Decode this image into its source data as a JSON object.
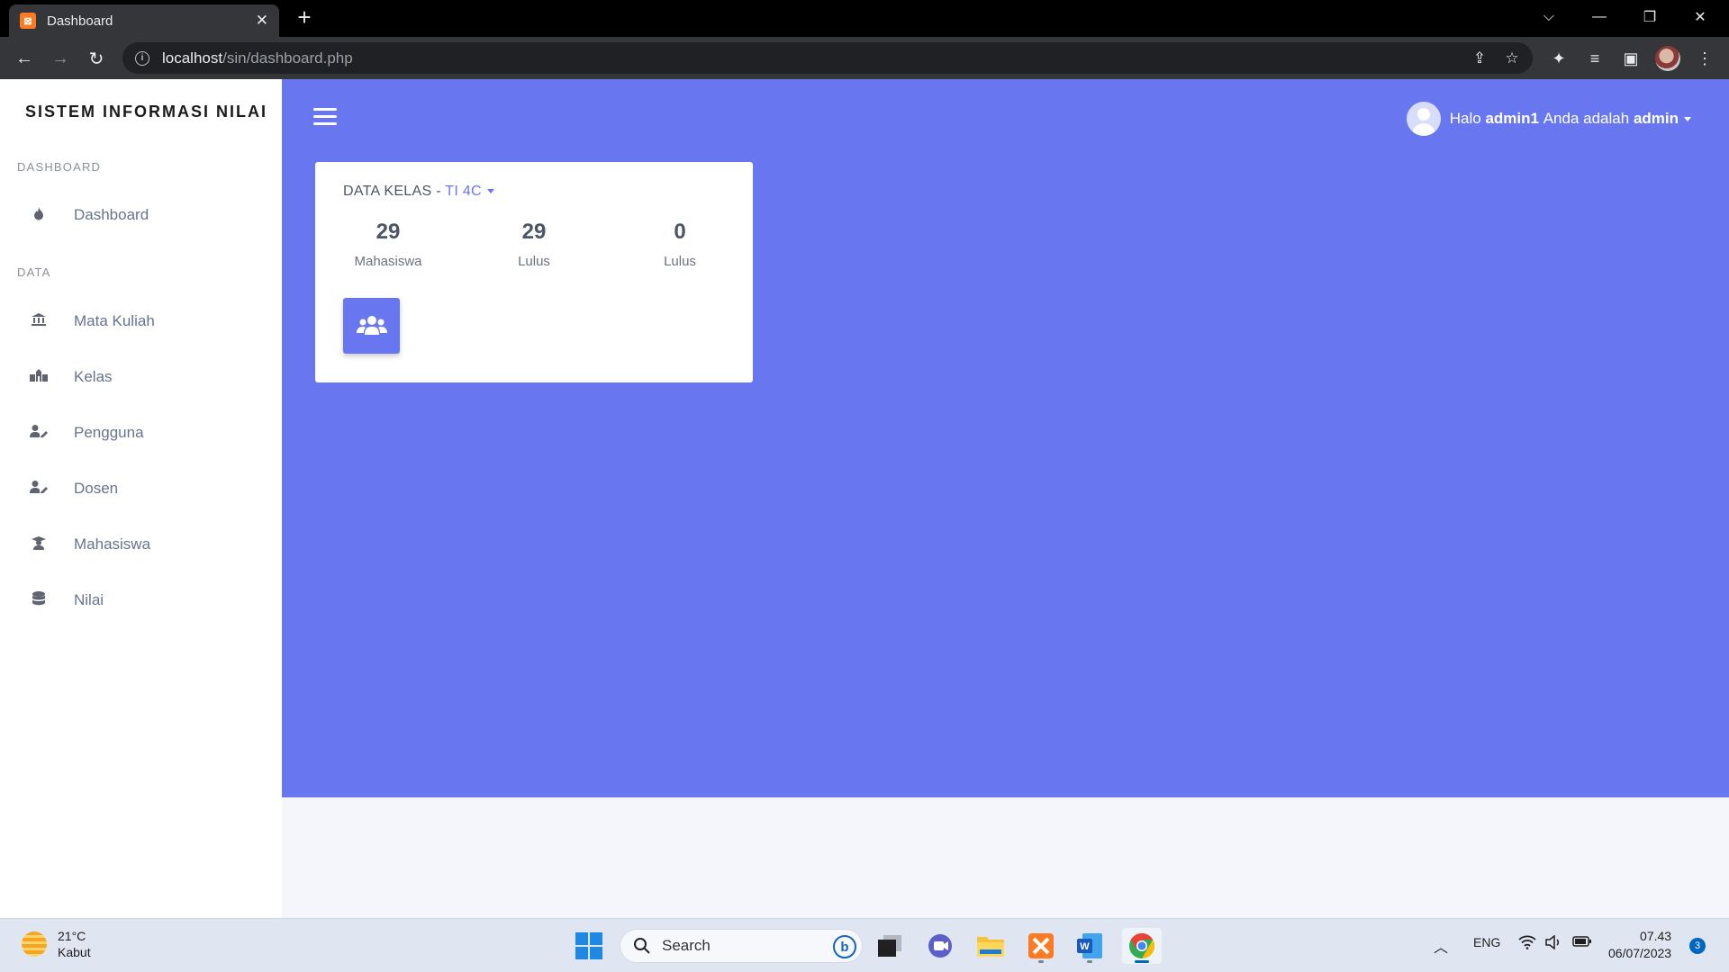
{
  "browser": {
    "tab_title": "Dashboard",
    "favicon_glyph": "⊠",
    "url_host": "localhost",
    "url_path": "/sin/dashboard.php"
  },
  "sidebar": {
    "brand": "SISTEM INFORMASI NILAI",
    "sections": [
      {
        "label": "DASHBOARD"
      },
      {
        "label": "DATA"
      }
    ],
    "items": [
      {
        "label": "Dashboard",
        "icon": "fire-icon"
      },
      {
        "label": "Mata Kuliah",
        "icon": "building-columns-icon"
      },
      {
        "label": "Kelas",
        "icon": "school-icon"
      },
      {
        "label": "Pengguna",
        "icon": "user-edit-icon"
      },
      {
        "label": "Dosen",
        "icon": "user-edit-icon"
      },
      {
        "label": "Mahasiswa",
        "icon": "graduate-icon"
      },
      {
        "label": "Nilai",
        "icon": "database-icon"
      }
    ]
  },
  "header": {
    "greeting": "Halo",
    "username": "admin1",
    "role_text": "Anda adalah",
    "role": "admin"
  },
  "card": {
    "title": "DATA KELAS - ",
    "kelas": "TI 4C",
    "stats": [
      {
        "value": "29",
        "label": "Mahasiswa"
      },
      {
        "value": "29",
        "label": "Lulus"
      },
      {
        "value": "0",
        "label": "Lulus"
      }
    ],
    "icon": "users-icon"
  },
  "taskbar": {
    "weather_temp": "21°C",
    "weather_desc": "Kabut",
    "search_placeholder": "Search",
    "language": "ENG",
    "time": "07.43",
    "date": "06/07/2023",
    "notification_count": "3"
  },
  "colors": {
    "accent": "#6877ef",
    "sidebar_bg": "#ffffff",
    "page_bg": "#f4f6fb"
  }
}
